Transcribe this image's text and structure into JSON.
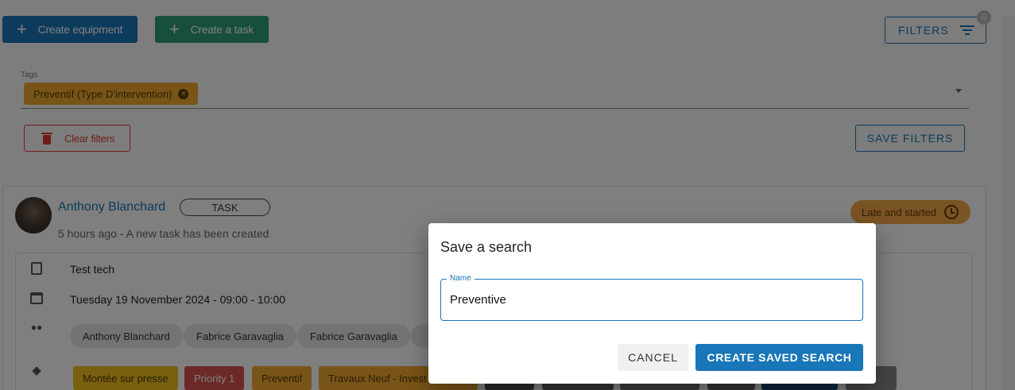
{
  "toolbar": {
    "create_equipment": "Create equipment",
    "create_task": "Create a task",
    "filters": "FILTERS",
    "filters_badge": "0"
  },
  "filters_panel": {
    "tags_label": "Tags",
    "selected_tag": "Preventif (Type D'intervention)",
    "clear_filters": "Clear filters",
    "save_filters": "SAVE FILTERS"
  },
  "activity": {
    "author": "Anthony Blanchard",
    "type_pill": "TASK",
    "subtitle": "5 hours ago - A new task has been created",
    "status_badge": "Late and started",
    "task_title": "Test tech",
    "schedule": "Tuesday 19 November 2024 - 09:00 - 10:00",
    "assignees": [
      "Anthony Blanchard",
      "Fabrice Garavaglia",
      "Fabrice Garavaglia"
    ],
    "tags": [
      "Montée sur presse",
      "Priority 1",
      "Preventif",
      "Travaux Neuf - Invest"
    ]
  },
  "dialog": {
    "title": "Save a search",
    "name_label": "Name",
    "name_value": "Preventive",
    "cancel": "CANCEL",
    "create": "CREATE SAVED SEARCH"
  },
  "colors": {
    "primary": "#1976b8",
    "green": "#2e9e74",
    "danger": "#e53935",
    "tag_orange": "#f0a830",
    "late_badge": "#f5a84a"
  }
}
